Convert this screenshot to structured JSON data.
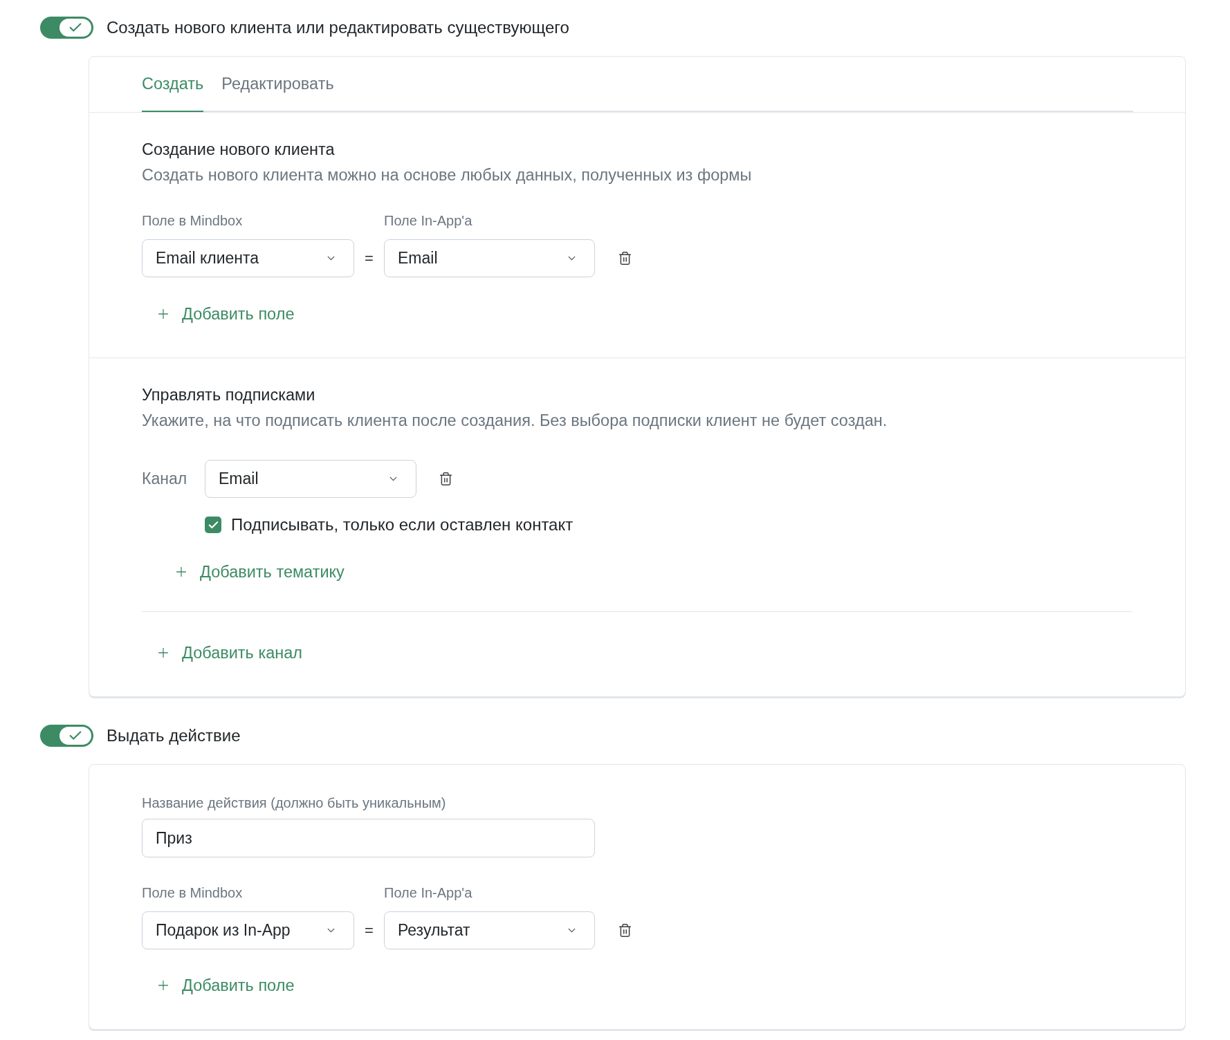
{
  "client_block": {
    "toggle": {
      "label": "Создать нового клиента или редактировать существующего",
      "on": true
    },
    "tabs": [
      {
        "label": "Создать",
        "selected": true
      },
      {
        "label": "Редактировать",
        "selected": false
      }
    ],
    "create_section": {
      "title": "Создание нового клиента",
      "description": "Создать нового клиента можно на основе любых данных, полученных из формы",
      "column_labels": [
        "Поле в Mindbox",
        "Поле In-App'a"
      ],
      "mappings": [
        {
          "mindbox_field": "Email клиента",
          "operator": "=",
          "inapp_field": "Email"
        }
      ],
      "add_field_button": "Добавить поле"
    },
    "subscriptions": {
      "title": "Управлять подписками",
      "description": "Укажите, на что подписать клиента после создания. Без выбора подписки клиент не будет создан.",
      "channels": [
        {
          "label": "Канал",
          "value": "Email",
          "only_if_contact": {
            "label": "Подписывать, только если оставлен контакт",
            "checked": true
          },
          "add_topic_button": "Добавить тематику"
        }
      ],
      "add_channel_button": "Добавить канал"
    }
  },
  "action_block": {
    "toggle": {
      "label": "Выдать действие",
      "on": true
    },
    "name_field": {
      "label": "Название действия (должно быть уникальным)",
      "value": "Приз"
    },
    "column_labels": [
      "Поле в Mindbox",
      "Поле In-App'a"
    ],
    "mappings": [
      {
        "mindbox_field": "Подарок из In-App",
        "operator": "=",
        "inapp_field": "Результат"
      }
    ],
    "add_field_button": "Добавить поле"
  }
}
